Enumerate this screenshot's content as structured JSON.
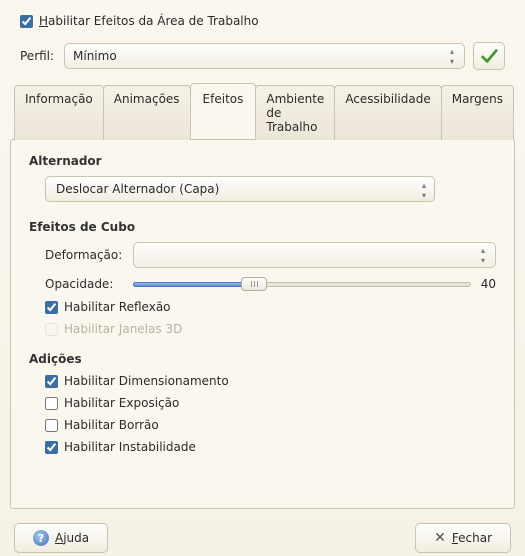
{
  "top_checkbox": {
    "label_pre": "H",
    "label_rest": "abilitar Efeitos da Área de Trabalho",
    "checked": true
  },
  "profile": {
    "label": "Perfil:",
    "selected": "Mínimo"
  },
  "tabs": [
    {
      "label": "Informação",
      "active": false
    },
    {
      "label": "Animações",
      "active": false
    },
    {
      "label": "Efeitos",
      "active": true
    },
    {
      "label": "Ambiente de Trabalho",
      "active": false
    },
    {
      "label": "Acessibilidade",
      "active": false
    },
    {
      "label": "Margens",
      "active": false
    }
  ],
  "sections": {
    "alternador": {
      "title": "Alternador",
      "selected": "Deslocar Alternador (Capa)"
    },
    "cubo": {
      "title": "Efeitos de Cubo",
      "deformacao_label": "Deformação:",
      "deformacao_value": "",
      "opacidade_label": "Opacidade:",
      "opacidade_value": 40,
      "reflexao": {
        "label": "Habilitar Reflexão",
        "checked": true
      },
      "janelas3d": {
        "label": "Habilitar Janelas 3D",
        "checked": false,
        "disabled": true
      }
    },
    "adicoes": {
      "title": "Adições",
      "items": [
        {
          "label": "Habilitar Dimensionamento",
          "checked": true
        },
        {
          "label": "Habilitar Exposição",
          "checked": false
        },
        {
          "label": "Habilitar Borrão",
          "checked": false
        },
        {
          "label": "Habilitar Instabilidade",
          "checked": true
        }
      ]
    }
  },
  "buttons": {
    "help_pre": "A",
    "help_rest": "juda",
    "close_pre": "F",
    "close_rest": "echar"
  }
}
